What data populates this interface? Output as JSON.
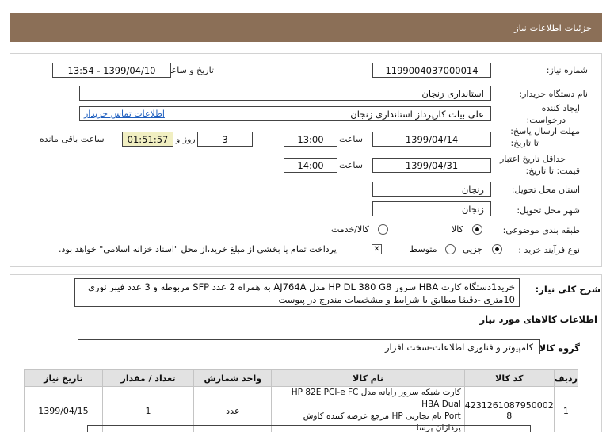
{
  "header": {
    "title": "جزئیات اطلاعات نیاز"
  },
  "form": {
    "need_number_label": "شماره نیاز:",
    "need_number": "1199004037000014",
    "announce_label": "تاریخ و ساعت اعلان عمومی:",
    "announce_value": "1399/04/10 - 13:54",
    "buyer_org_label": "نام دستگاه خریدار:",
    "buyer_org": "استانداری زنجان",
    "requester_label_1": "ایجاد کننده",
    "requester_label_2": "درخواست:",
    "requester": "علی بیات کارپرداز  استانداری زنجان",
    "contact_link": "اطلاعات تماس خریدار",
    "reply_deadline_label_1": "مهلت ارسال پاسخ:",
    "reply_deadline_label_2": "تا تاریخ:",
    "reply_date": "1399/04/14",
    "time_label": "ساعت",
    "reply_time": "13:00",
    "days_value": "3",
    "days_label": "روز و",
    "remaining_time": "01:51:57",
    "remaining_label": "ساعت باقی مانده",
    "validity_label_1": "حداقل تاریخ اعتبار",
    "validity_label_2": "قیمت: تا تاریخ:",
    "validity_date": "1399/04/31",
    "validity_time_label": "ساعت",
    "validity_time": "14:00",
    "province_label": "استان محل تحویل:",
    "province": "زنجان",
    "city_label": "شهر محل تحویل:",
    "city": "زنجان",
    "category_label": "طبقه بندی موضوعی:",
    "category_options": [
      "کالا",
      "کالا/خدمت"
    ],
    "process_label": "نوع فرآیند خرید :",
    "process_options": [
      "جزیی",
      "متوسط"
    ],
    "payment_note": "پرداخت تمام یا بخشی از مبلغ خرید،از محل \"اسناد خزانه اسلامی\" خواهد بود."
  },
  "description": {
    "label": "شرح کلی نیاز:",
    "text": "خرید1دستگاه کارت HBA سرور HP DL 380 G8 مدل AJ764A به همراه 2 عدد SFP مربوطه و 3 عدد فیبر نوری 10متری -دقیقا مطابق با شرایط و مشخصات مندرج در پیوست"
  },
  "goods": {
    "section_title": "اطلاعات کالاهای مورد نیاز",
    "group_label": "گروه کالا:",
    "group_value": "کامپیوتر و فناوری اطلاعات-سخت افزار",
    "columns": [
      "ردیف",
      "کد کالا",
      "نام کالا",
      "واحد شمارش",
      "تعداد / مقدار",
      "تاریخ نیاز"
    ],
    "rows": [
      {
        "row": "1",
        "code": "4231261087950002​8",
        "name_line1": "کارت شبکه سرور رایانه مدل HP 82E PCI-e FC HBA Dual",
        "name_line2": "Port نام تجارتی HP مرجع عرضه کننده کاوش پردازان پرسا",
        "unit": "عدد",
        "qty": "1",
        "date": "1399/04/15"
      }
    ]
  }
}
